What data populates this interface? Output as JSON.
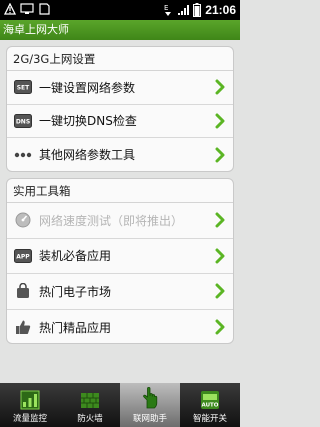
{
  "statusbar": {
    "time": "21:06"
  },
  "app": {
    "title": "海卓上网大师"
  },
  "network_card": {
    "title": "2G/3G上网设置",
    "items": [
      {
        "label": "一键设置网络参数",
        "icon": "set-icon",
        "icon_text": "SET"
      },
      {
        "label": "一键切换DNS检查",
        "icon": "dns-icon",
        "icon_text": "DNS"
      },
      {
        "label": "其他网络参数工具",
        "icon": "more-dots-icon"
      }
    ]
  },
  "tools_card": {
    "title": "实用工具箱",
    "items": [
      {
        "label": "网络速度测试（即将推出）",
        "icon": "speed-gauge-icon",
        "disabled": true
      },
      {
        "label": "装机必备应用",
        "icon": "app-icon",
        "icon_text": "APP"
      },
      {
        "label": "热门电子市场",
        "icon": "shopping-bag-icon"
      },
      {
        "label": "热门精品应用",
        "icon": "thumbs-up-icon"
      }
    ]
  },
  "tabs": [
    {
      "label": "流量监控",
      "icon": "traffic-monitor-icon"
    },
    {
      "label": "防火墙",
      "icon": "firewall-icon"
    },
    {
      "label": "联网助手",
      "icon": "hand-pointer-icon",
      "active": true
    },
    {
      "label": "智能开关",
      "icon": "auto-switch-icon",
      "icon_text": "AUTO"
    }
  ],
  "colors": {
    "accent": "#4a9a22",
    "chevron": "#5bb524"
  }
}
